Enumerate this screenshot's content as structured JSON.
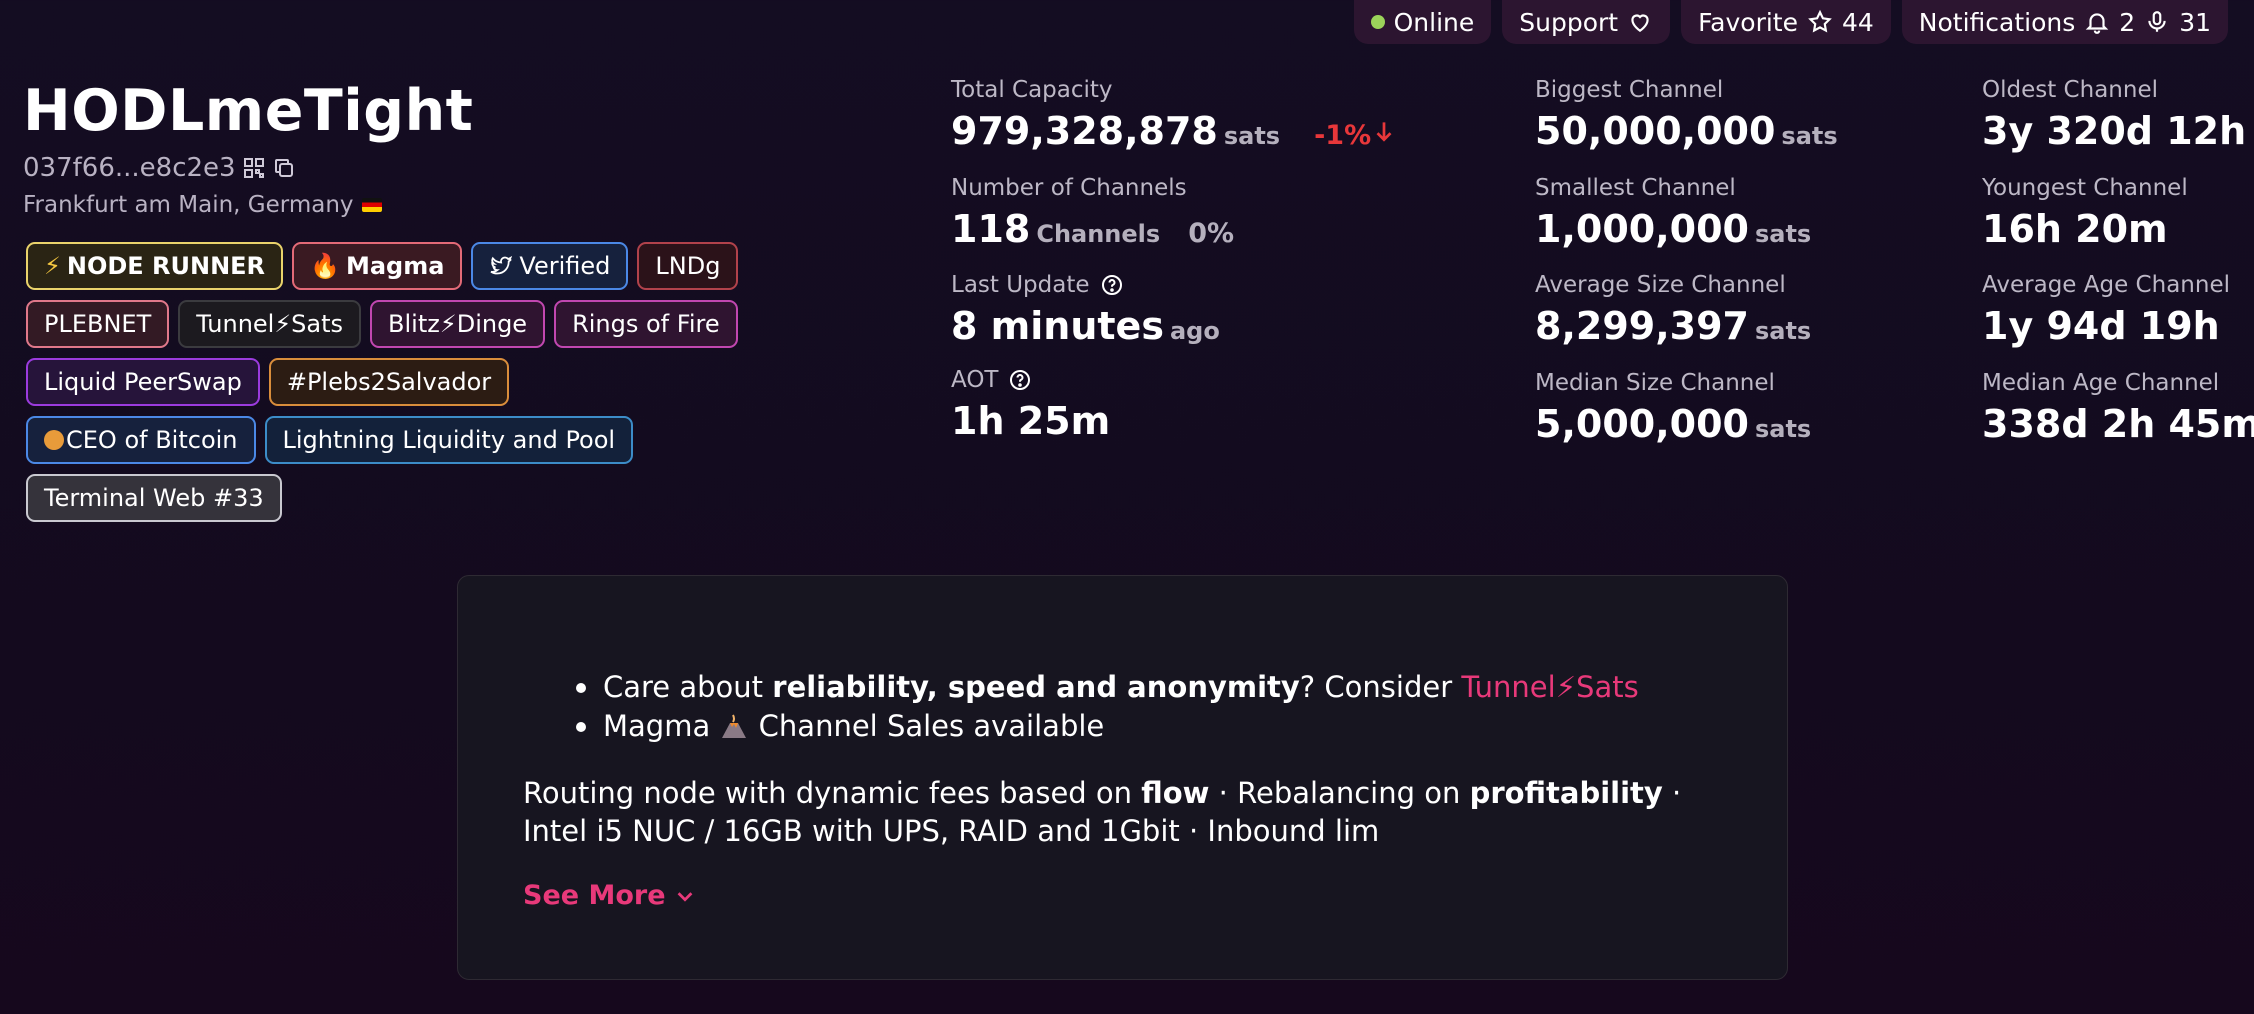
{
  "topbar": {
    "online": "Online",
    "support": "Support",
    "favorite": "Favorite",
    "favorite_count": "44",
    "notifications": "Notifications",
    "notif_count": "2",
    "mic_count": "31",
    "online_color": "#9bd35a"
  },
  "node": {
    "title": "HODLmeTight",
    "pubkey": "037f66...e8c2e3",
    "location": "Frankfurt am Main, Germany"
  },
  "badges": [
    {
      "icon": "lightning-icon",
      "label": "NODE RUNNER"
    },
    {
      "icon": "fire-icon",
      "label": "Magma"
    },
    {
      "icon": "twitter-icon",
      "label": "Verified"
    },
    {
      "label": "LNDg"
    },
    {
      "label": "PLEBNET"
    },
    {
      "label": "Tunnel⚡Sats"
    },
    {
      "label": "Blitz⚡Dinge"
    },
    {
      "label": "Rings of Fire"
    },
    {
      "label": "Liquid PeerSwap"
    },
    {
      "label": "#Plebs2Salvador"
    },
    {
      "icon": "coin-icon",
      "label": "CEO of Bitcoin"
    },
    {
      "label": "Lightning Liquidity and Pool"
    },
    {
      "label": "Terminal Web #33"
    }
  ],
  "stats": {
    "capacity": {
      "label": "Total Capacity",
      "value": "979,328,878",
      "unit": "sats",
      "change": "-1%"
    },
    "channels": {
      "label": "Number of Channels",
      "value": "118",
      "unit": "Channels",
      "change": "0%"
    },
    "update": {
      "label": "Last Update",
      "value": "8 minutes",
      "unit": "ago"
    },
    "aot": {
      "label": "AOT",
      "value": "1h 25m"
    },
    "biggest": {
      "label": "Biggest Channel",
      "value": "50,000,000",
      "unit": "sats"
    },
    "smallest": {
      "label": "Smallest Channel",
      "value": "1,000,000",
      "unit": "sats"
    },
    "avg_size": {
      "label": "Average Size Channel",
      "value": "8,299,397",
      "unit": "sats"
    },
    "median_size": {
      "label": "Median Size Channel",
      "value": "5,000,000",
      "unit": "sats"
    },
    "oldest": {
      "label": "Oldest Channel",
      "value": "3y 320d 12h"
    },
    "youngest": {
      "label": "Youngest Channel",
      "value": "16h 20m"
    },
    "avg_age": {
      "label": "Average Age Channel",
      "value": "1y 94d 19h"
    },
    "median_age": {
      "label": "Median Age Channel",
      "value": "338d 2h 45m"
    }
  },
  "description": {
    "bullet1_pre": "Care about ",
    "bullet1_bold": "reliability, speed and anonymity",
    "bullet1_mid": "? Consider ",
    "bullet1_link": "Tunnel⚡Sats",
    "bullet2_pre": "Magma",
    "bullet2_post": " Channel Sales available",
    "p_pre": "Routing node with dynamic fees based on ",
    "p_bold1": "flow",
    "p_mid": " · Rebalancing on ",
    "p_bold2": "profitability",
    "p_post": " · Intel i5 NUC / 16GB with UPS, RAID and 1Gbit · Inbound lim",
    "see_more": "See More"
  }
}
